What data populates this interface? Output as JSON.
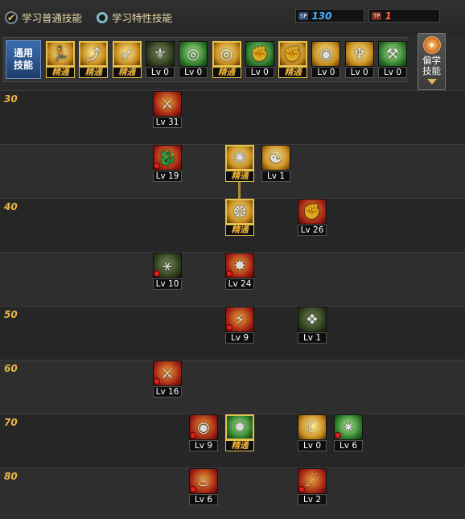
{
  "header": {
    "option_normal": {
      "label": "学习普通技能",
      "selected": true
    },
    "option_special": {
      "label": "学习特性技能",
      "selected": false
    },
    "sp": {
      "tag": "SP",
      "value": "130",
      "color": "#4ab0ff"
    },
    "tp": {
      "tag": "TP",
      "value": "1",
      "color": "#ff6a3a"
    }
  },
  "common": {
    "label_line1": "通用",
    "label_line2": "技能",
    "skills": [
      {
        "icon": "run-icon",
        "label": "精通",
        "mastered": true
      },
      {
        "icon": "leap-icon",
        "label": "精通",
        "mastered": true
      },
      {
        "icon": "dash-icon",
        "label": "精通",
        "mastered": true
      },
      {
        "icon": "wings-icon",
        "label": "Lv 0",
        "mastered": false
      },
      {
        "icon": "target-icon",
        "label": "Lv 0",
        "mastered": false
      },
      {
        "icon": "target-icon",
        "label": "精通",
        "mastered": true
      },
      {
        "icon": "strike-icon",
        "label": "Lv 0",
        "mastered": false
      },
      {
        "icon": "strike-icon",
        "label": "精通",
        "mastered": true
      },
      {
        "icon": "eye-icon",
        "label": "Lv 0",
        "mastered": false
      },
      {
        "icon": "flex-icon",
        "label": "Lv 0",
        "mastered": false
      },
      {
        "icon": "hammer-icon",
        "label": "Lv 0",
        "mastered": false
      }
    ]
  },
  "advanced": {
    "line1": "偏学",
    "line2": "技能"
  },
  "tree": {
    "levels": [
      "30",
      "",
      "40",
      "",
      "50",
      "60",
      "70",
      "80"
    ],
    "skills": [
      {
        "row": 0,
        "col": 0,
        "style": "red",
        "icon": "slash-icon",
        "label": "Lv 31",
        "mastered": false,
        "locked": false
      },
      {
        "row": 1,
        "col": 0,
        "style": "red",
        "icon": "dragon-icon",
        "label": "Lv 19",
        "mastered": false,
        "locked": true
      },
      {
        "row": 1,
        "col": 2,
        "style": "gold",
        "icon": "flame-icon",
        "label": "精通",
        "mastered": true,
        "locked": false
      },
      {
        "row": 1,
        "col": 3,
        "style": "gold",
        "icon": "monk-icon",
        "label": "Lv 1",
        "mastered": false,
        "locked": false
      },
      {
        "row": 2,
        "col": 2,
        "style": "gold",
        "icon": "orb-icon",
        "label": "精通",
        "mastered": true,
        "locked": false
      },
      {
        "row": 2,
        "col": 4,
        "style": "red",
        "icon": "fist-icon",
        "label": "Lv 26",
        "mastered": false,
        "locked": false
      },
      {
        "row": 3,
        "col": 0,
        "style": "dark",
        "icon": "rune-icon",
        "label": "Lv 10",
        "mastered": false,
        "locked": true
      },
      {
        "row": 3,
        "col": 2,
        "style": "red",
        "icon": "burst-icon",
        "label": "Lv 24",
        "mastered": false,
        "locked": true
      },
      {
        "row": 4,
        "col": 2,
        "style": "red",
        "icon": "kick-icon",
        "label": "Lv 9",
        "mastered": false,
        "locked": true
      },
      {
        "row": 4,
        "col": 4,
        "style": "dark",
        "icon": "spirit-icon",
        "label": "Lv 1",
        "mastered": false,
        "locked": false
      },
      {
        "row": 5,
        "col": 0,
        "style": "red",
        "icon": "blade-icon",
        "label": "Lv 16",
        "mastered": false,
        "locked": true
      },
      {
        "row": 6,
        "col": 1,
        "style": "red",
        "icon": "eye-icon",
        "label": "Lv 9",
        "mastered": false,
        "locked": true
      },
      {
        "row": 6,
        "col": 2,
        "style": "green",
        "icon": "nova-icon",
        "label": "精通",
        "mastered": true,
        "locked": false
      },
      {
        "row": 6,
        "col": 4,
        "style": "gold",
        "icon": "claw-icon",
        "label": "Lv 0",
        "mastered": false,
        "locked": false
      },
      {
        "row": 6,
        "col": 5,
        "style": "green",
        "icon": "splash-icon",
        "label": "Lv 6",
        "mastered": false,
        "locked": true
      },
      {
        "row": 7,
        "col": 1,
        "style": "red",
        "icon": "phoenix-icon",
        "label": "Lv 6",
        "mastered": false,
        "locked": true
      },
      {
        "row": 7,
        "col": 4,
        "style": "red",
        "icon": "fire-claw-icon",
        "label": "Lv 2",
        "mastered": false,
        "locked": true
      }
    ]
  }
}
